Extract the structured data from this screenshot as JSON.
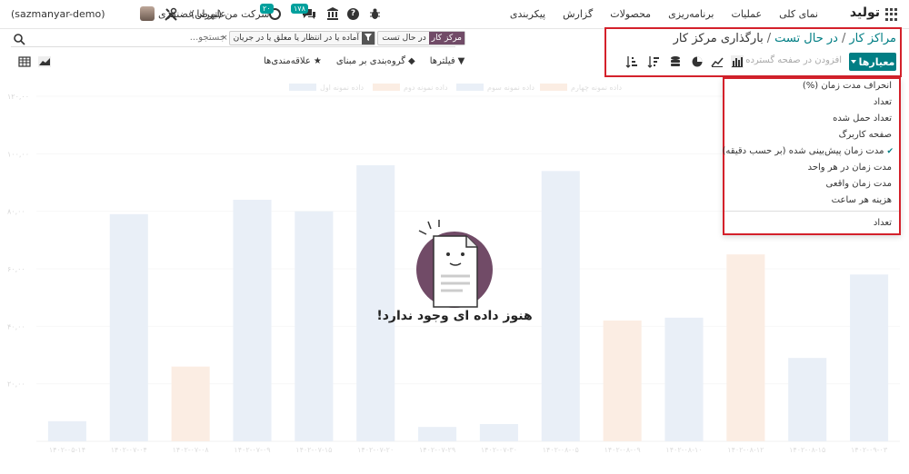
{
  "nav": {
    "brand": "تولید",
    "menu": [
      "نمای کلی",
      "عملیات",
      "برنامه‌ریزی",
      "محصولات",
      "گزارش",
      "پیکربندی"
    ],
    "chat_badge": "۱۷۸",
    "activity_badge": "۲۰",
    "company": "شرکت من (تهران)",
    "user": "علیرضا غضنفری",
    "db": "(sazmanyar-demo)"
  },
  "breadcrumb": {
    "root": "مراکز کار",
    "mid": "در حال تست",
    "current": "بارگذاری مرکز کار"
  },
  "search": {
    "placeholder": "جستجو...",
    "facets": [
      {
        "label": "مرکز کار",
        "value": "در حال تست"
      },
      {
        "label": "",
        "value": "آماده یا در انتظار یا معلق یا در جریان"
      }
    ]
  },
  "toolbar": {
    "measures_label": "معیارها",
    "insert_label": "افزودن در صفحه گسترده"
  },
  "filters": {
    "filters_label": "فیلترها",
    "groupby_label": "گروه‌بندی بر مبنای",
    "favorites_label": "علاقه‌مندی‌ها"
  },
  "dropdown": {
    "items": [
      {
        "label": "انحراف مدت زمان (%)",
        "selected": false
      },
      {
        "label": "تعداد",
        "selected": false
      },
      {
        "label": "تعداد حمل شده",
        "selected": false
      },
      {
        "label": "صفحه کاربرگ",
        "selected": false
      },
      {
        "label": "مدت زمان پیش‌بینی شده (بر حسب دقیقه)",
        "selected": true
      },
      {
        "label": "مدت زمان در هر واحد",
        "selected": false
      },
      {
        "label": "مدت زمان واقعی",
        "selected": false
      },
      {
        "label": "هزینه هر ساعت",
        "selected": false
      }
    ],
    "count_label": "تعداد"
  },
  "empty": {
    "title": "هنوز داده ای وجود ندارد!"
  },
  "colors": {
    "accent": "#017e84",
    "brand": "#714b67",
    "highlight": "#d4212b"
  },
  "chart_data": {
    "type": "bar",
    "yticks": [
      "۱۲۰,۰۰",
      "۱۰۰,۰۰",
      "۸۰,۰۰",
      "۶۰,۰۰",
      "۴۰,۰۰",
      "۲۰,۰۰"
    ],
    "legend": [
      "داده نمونه اول",
      "داده نمونه دوم",
      "داده نمونه سوم",
      "داده نمونه چهارم"
    ],
    "ylim": [
      0,
      120
    ],
    "bars": [
      {
        "x": "۱۴۰۲-۰۵-۱۴",
        "value": 7,
        "color": "#c9d8ec"
      },
      {
        "x": "۱۴۰۲-۰۷-۰۴",
        "value": 79,
        "color": "#c9d8ec"
      },
      {
        "x": "۱۴۰۲-۰۷-۰۸",
        "value": 26,
        "color": "#f5d2b8"
      },
      {
        "x": "۱۴۰۲-۰۷-۰۹",
        "value": 84,
        "color": "#c9d8ec"
      },
      {
        "x": "۱۴۰۲-۰۷-۱۵",
        "value": 80,
        "color": "#c9d8ec"
      },
      {
        "x": "۱۴۰۲-۰۷-۲۰",
        "value": 96,
        "color": "#c9d8ec"
      },
      {
        "x": "۱۴۰۲-۰۷-۲۹",
        "value": 5,
        "color": "#c9d8ec"
      },
      {
        "x": "۱۴۰۲-۰۷-۳۰",
        "value": 6,
        "color": "#c9d8ec"
      },
      {
        "x": "۱۴۰۲-۰۸-۰۵",
        "value": 94,
        "color": "#c9d8ec"
      },
      {
        "x": "۱۴۰۲-۰۸-۰۹",
        "value": 42,
        "color": "#f5d2b8"
      },
      {
        "x": "۱۴۰۲-۰۸-۱۰",
        "value": 43,
        "color": "#c9d8ec"
      },
      {
        "x": "۱۴۰۲-۰۸-۱۲",
        "value": 65,
        "color": "#f5d2b8"
      },
      {
        "x": "۱۴۰۲-۰۸-۱۵",
        "value": 29,
        "color": "#c9d8ec"
      },
      {
        "x": "۱۴۰۲-۰۹-۰۳",
        "value": 58,
        "color": "#c9d8ec"
      }
    ]
  }
}
